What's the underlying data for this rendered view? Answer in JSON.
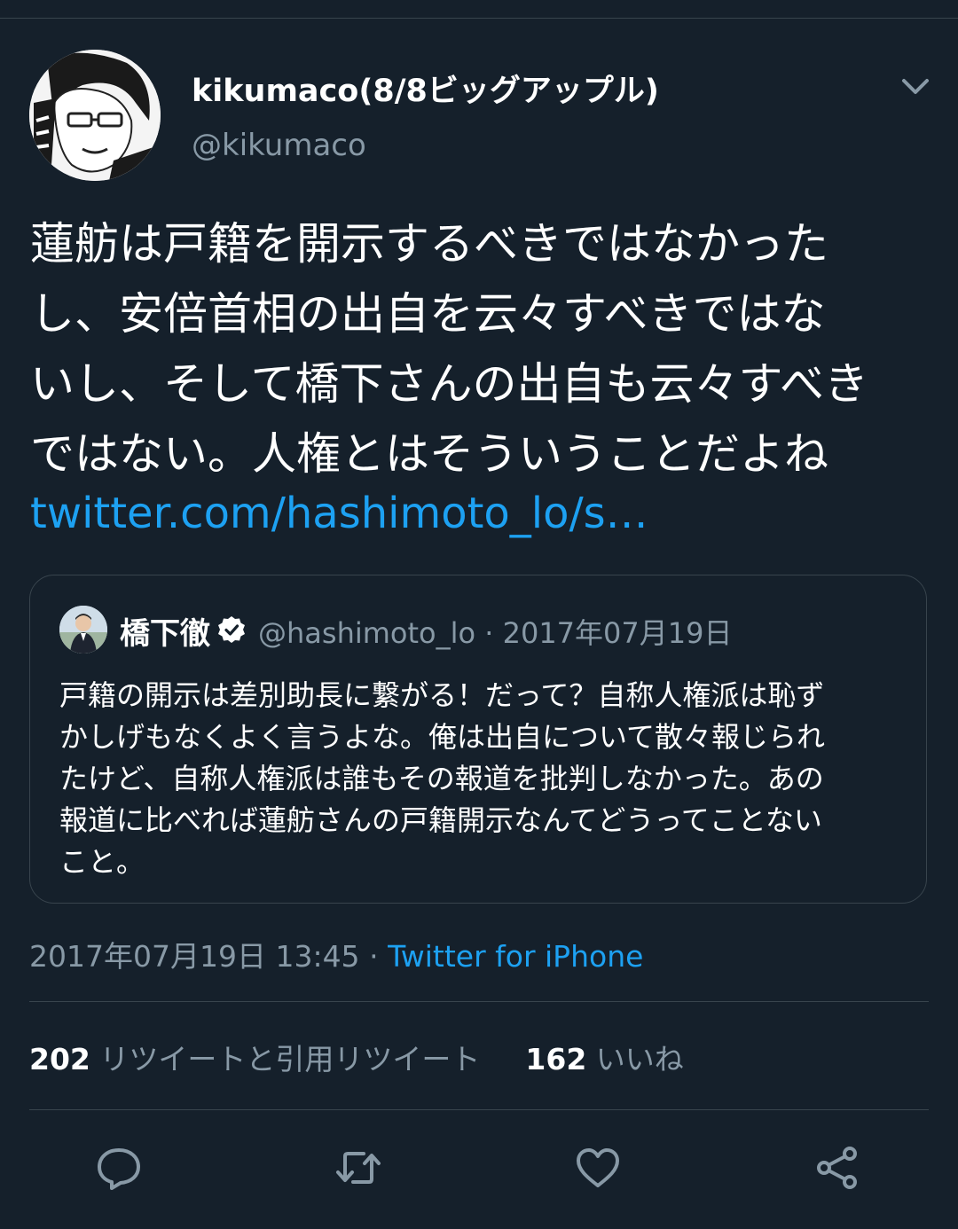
{
  "author": {
    "display_name": "kikumaco(8/8ビッグアップル)",
    "handle": "@kikumaco",
    "avatar_icon": "manga-portrait-avatar"
  },
  "tweet": {
    "lines": [
      "蓮舫は戸籍を開示するべきではなかった",
      "し、安倍首相の出自を云々すべきではな",
      "いし、そして橋下さんの出自も云々すべき",
      "ではない。人権とはそういうことだよね"
    ],
    "link": "twitter.com/hashimoto_lo/s…",
    "timestamp": "2017年07月19日 13:45",
    "separator": "·",
    "source": "Twitter for iPhone"
  },
  "quoted": {
    "name": "橋下徹",
    "handle": "@hashimoto_lo",
    "separator": "·",
    "date": "2017年07月19日",
    "verified": true,
    "lines": [
      "戸籍の開示は差別助長に繋がる！だって？自称人権派は恥ず",
      "かしげもなくよく言うよな。俺は出自について散々報じられ",
      "たけど、自称人権派は誰もその報道を批判しなかった。あの",
      "報道に比べれば蓮舫さんの戸籍開示なんてどうってことない",
      "こと。"
    ]
  },
  "stats": {
    "retweets_count": "202",
    "retweets_label": "リツイートと引用リツイート",
    "likes_count": "162",
    "likes_label": "いいね"
  },
  "actions": [
    "reply-icon",
    "retweet-icon",
    "like-icon",
    "share-icon"
  ],
  "colors": {
    "background": "#15202b",
    "text": "#ffffff",
    "secondary": "#8899a6",
    "accent": "#1da1f2",
    "border": "#38444d"
  }
}
